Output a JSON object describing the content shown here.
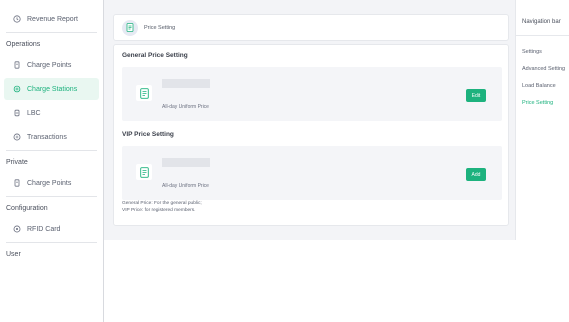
{
  "sidebar": {
    "top_item": {
      "label": "Revenue Report",
      "icon": "clock-icon"
    },
    "sections": [
      {
        "title": "Operations",
        "items": [
          {
            "label": "Charge Points",
            "icon": "charger-icon",
            "active": false
          },
          {
            "label": "Charge Stations",
            "icon": "station-icon",
            "active": true
          },
          {
            "label": "LBC",
            "icon": "lbc-icon",
            "active": false
          },
          {
            "label": "Transactions",
            "icon": "transactions-icon",
            "active": false
          }
        ]
      },
      {
        "title": "Private",
        "items": [
          {
            "label": "Charge Points",
            "icon": "charger-icon",
            "active": false
          }
        ]
      },
      {
        "title": "Configuration",
        "items": [
          {
            "label": "RFID Card",
            "icon": "card-icon",
            "active": false
          }
        ]
      },
      {
        "title": "User",
        "items": []
      }
    ]
  },
  "header": {
    "title": "Price Setting",
    "icon": "document-icon"
  },
  "main": {
    "general": {
      "title": "General Price Setting",
      "description": "All-day Uniform Price",
      "button_label": "Edit"
    },
    "vip": {
      "title": "VIP Price Setting",
      "description": "All-day Uniform Price",
      "button_label": "Add"
    },
    "note_line1": "General Price: For the general public;",
    "note_line2": "VIP Price: for registered members."
  },
  "right_nav": {
    "title": "Navigation bar",
    "items": [
      {
        "label": "Settings",
        "active": false
      },
      {
        "label": "Advanced Setting",
        "active": false
      },
      {
        "label": "Load Balance",
        "active": false
      },
      {
        "label": "Price Setting",
        "active": true
      }
    ]
  },
  "colors": {
    "accent": "#1db27e",
    "active_bg": "#e9f7f1",
    "page_bg": "#f3f4f7"
  }
}
